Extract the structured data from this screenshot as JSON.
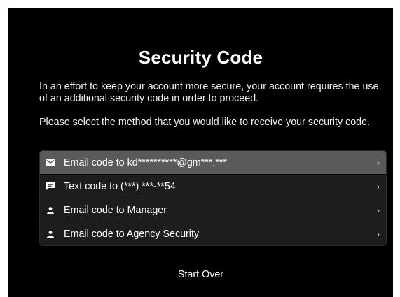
{
  "title": "Security Code",
  "intro_text": "In an effort to keep your account more secure, your account requires the use of an additional security code in order to proceed.",
  "select_text": "Please select the method that you would like to receive your security code.",
  "options": [
    {
      "icon": "envelope-icon",
      "label": "Email code to kd**********@gm***.***",
      "chevron": "›"
    },
    {
      "icon": "message-icon",
      "label": "Text code to (***) ***-**54",
      "chevron": "›"
    },
    {
      "icon": "person-icon",
      "label": "Email code to Manager",
      "chevron": "›"
    },
    {
      "icon": "person-icon",
      "label": "Email code to Agency Security",
      "chevron": "›"
    }
  ],
  "start_over_label": "Start Over",
  "colors": {
    "background": "#000000",
    "selected_row": "#5a5a5a",
    "row": "#1d1d1d"
  }
}
